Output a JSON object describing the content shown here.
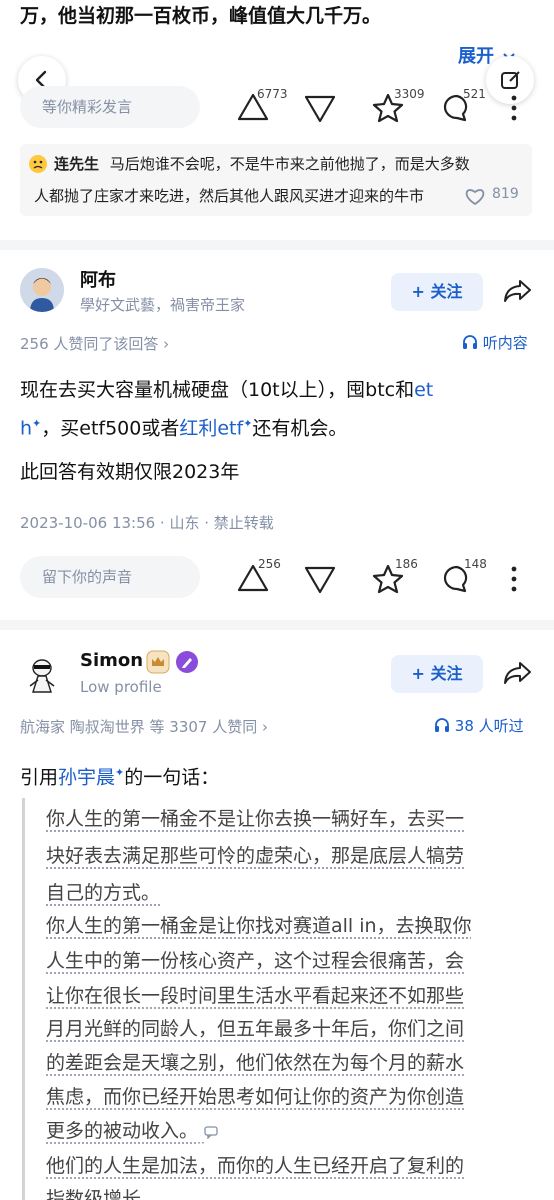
{
  "prev_answer": {
    "tail_text": "万，他当初那一百枚币，峰值值大几千万。",
    "expand_label": "展开",
    "comment_placeholder": "等你精彩发言",
    "upvotes": "6773",
    "favorites": "3309",
    "comments": "521",
    "top_comment": {
      "author": "连先生",
      "line1": "马后炮谁不会呢，不是牛市来之前他抛了，而是大多数",
      "line2": "人都抛了庄家才来吃进，然后其他人跟风买进才迎来的牛市",
      "likes": "819"
    }
  },
  "answer_abu": {
    "name": "阿布",
    "bio": "學好文武藝，禍害帝王家",
    "follow_label": "+ 关注",
    "agree_text": "256 人赞同了该回答 ›",
    "listen_label": "听内容",
    "body_line1_a": "现在去买大容量机械硬盘（10t以上），囤btc和",
    "body_line1_link": "et",
    "body_line2_link": "h",
    "body_line2_b": "，买etf500或者",
    "body_line2_link2": "红利etf",
    "body_line2_c": "还有机会。",
    "body_line3": "此回答有效期仅限2023年",
    "meta": "2023-10-06 13:56 · 山东 · 禁止转载",
    "comment_placeholder": "留下你的声音",
    "upvotes": "256",
    "favorites": "186",
    "comments": "148"
  },
  "answer_simon": {
    "name": "Simon",
    "bio": "Low profile",
    "follow_label": "+ 关注",
    "agree_text": "航海家 陶叔淘世界 等 3307 人赞同 ›",
    "listen_label": "38 人听过",
    "intro_a": "引用",
    "intro_link": "孙宇晨",
    "intro_b": "的一句话：",
    "quote_lines": [
      "你人生的第一桶金不是让你去换一辆好车，去买一",
      "块好表去满足那些可怜的虚荣心，那是底层人犒劳",
      "自己的方式。",
      "你人生的第一桶金是让你找对赛道all in，去换取你",
      "人生中的第一份核心资产，这个过程会很痛苦，会",
      "让你在很长一段时间里生活水平看起来还不如那些",
      "月月光鲜的同龄人，但五年最多十年后，你们之间",
      "的差距会是天壤之别，他们依然在为每个月的薪水",
      "焦虑，而你已经开始思考如何让你的资产为你创造",
      "更多的被动收入。",
      "他们的人生是加法，而你的人生已经开启了复利的",
      "指数级增长。"
    ]
  },
  "colors": {
    "brand_blue": "#1a5fcc",
    "follow_bg": "#eaf1fd",
    "separator": "#f4f5f7"
  },
  "icons": [
    "back-icon",
    "edit-icon",
    "upvote-icon",
    "downvote-icon",
    "star-icon",
    "comment-icon",
    "more-icon",
    "heart-icon",
    "share-icon",
    "headphone-icon",
    "emoji-icon",
    "badge-icon"
  ]
}
